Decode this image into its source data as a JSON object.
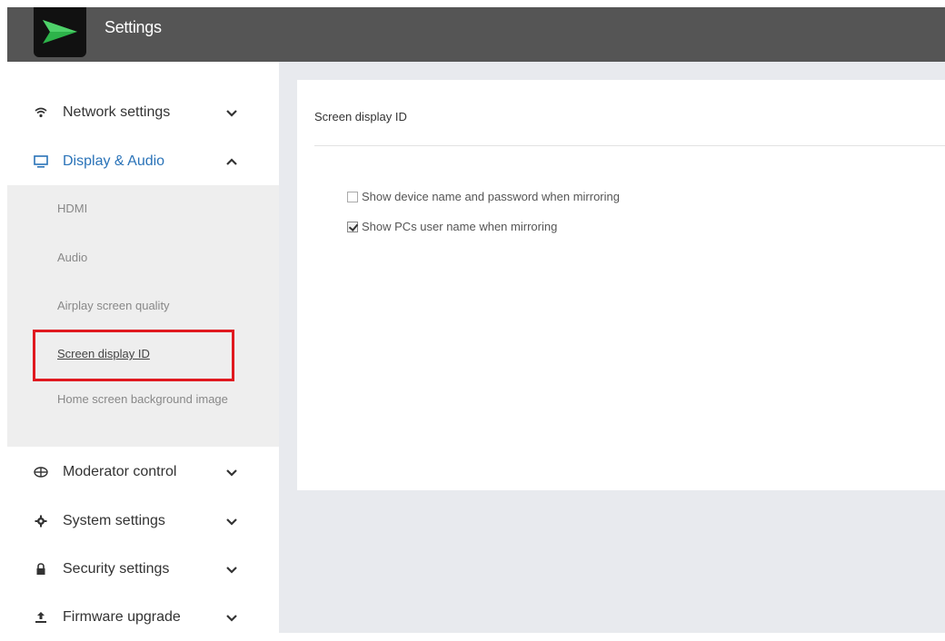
{
  "app": {
    "title": "Settings"
  },
  "sidebar": {
    "items": [
      {
        "label": "Network settings",
        "icon": "wifi-icon",
        "expanded": false
      },
      {
        "label": "Display & Audio",
        "icon": "monitor-icon",
        "expanded": true
      },
      {
        "label": "Moderator control",
        "icon": "moderator-icon",
        "expanded": false
      },
      {
        "label": "System settings",
        "icon": "gear-icon",
        "expanded": false
      },
      {
        "label": "Security settings",
        "icon": "lock-icon",
        "expanded": false
      },
      {
        "label": "Firmware upgrade",
        "icon": "upload-icon",
        "expanded": false
      }
    ],
    "display_audio_subitems": [
      {
        "label": "HDMI"
      },
      {
        "label": "Audio"
      },
      {
        "label": "Airplay screen quality"
      },
      {
        "label": "Screen display ID",
        "selected": true
      },
      {
        "label": "Home screen background image"
      }
    ]
  },
  "panel": {
    "title": "Screen display ID",
    "options": [
      {
        "label": "Show device name and password when mirroring",
        "checked": false
      },
      {
        "label": "Show PCs user name when mirroring",
        "checked": true
      }
    ]
  },
  "colors": {
    "topbar": "#555555",
    "accent": "#2a73b8",
    "highlight": "#e0191f",
    "content_bg": "#e8eaee"
  }
}
